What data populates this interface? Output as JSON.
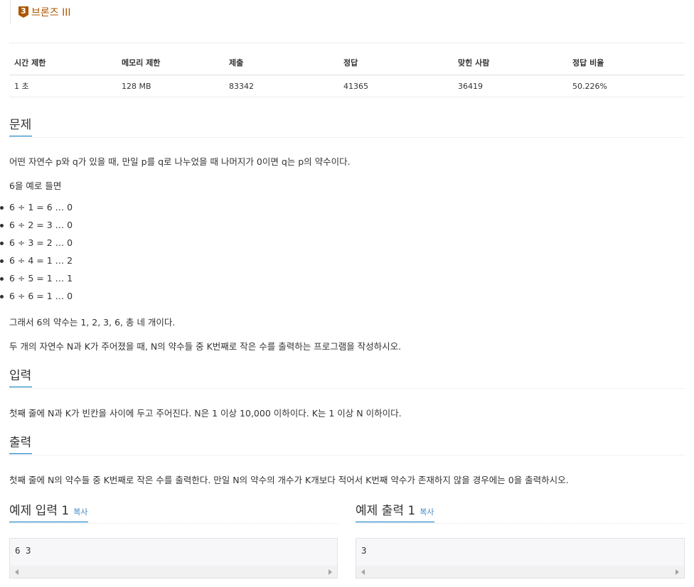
{
  "tier": {
    "badge": "3",
    "label": "브론즈 III"
  },
  "info_table": {
    "headers": [
      "시간 제한",
      "메모리 제한",
      "제출",
      "정답",
      "맞힌 사람",
      "정답 비율"
    ],
    "values": [
      "1 초",
      "128 MB",
      "83342",
      "41365",
      "36419",
      "50.226%"
    ]
  },
  "problem": {
    "title": "문제",
    "para1": "어떤 자연수 p와 q가 있을 때, 만일 p를 q로 나누었을 때 나머지가 0이면 q는 p의 약수이다.",
    "para2": "6을 예로 들면",
    "list": [
      "6 ÷ 1 = 6 … 0",
      "6 ÷ 2 = 3 … 0",
      "6 ÷ 3 = 2 … 0",
      "6 ÷ 4 = 1 … 2",
      "6 ÷ 5 = 1 … 1",
      "6 ÷ 6 = 1 … 0"
    ],
    "para3": "그래서 6의 약수는 1, 2, 3, 6, 총 네 개이다.",
    "para4": "두 개의 자연수 N과 K가 주어졌을 때, N의 약수들 중 K번째로 작은 수를 출력하는 프로그램을 작성하시오."
  },
  "input": {
    "title": "입력",
    "text": "첫째 줄에 N과 K가 빈칸을 사이에 두고 주어진다. N은 1 이상 10,000 이하이다. K는 1 이상 N 이하이다."
  },
  "output": {
    "title": "출력",
    "text": "첫째 줄에 N의 약수들 중 K번째로 작은 수를 출력한다. 만일 N의 약수의 개수가 K개보다 적어서 K번째 약수가 존재하지 않을 경우에는 0을 출력하시오."
  },
  "sample_input": {
    "title": "예제 입력 1",
    "copy_label": "복사",
    "content": "6 3"
  },
  "sample_output": {
    "title": "예제 출력 1",
    "copy_label": "복사",
    "content": "3"
  },
  "colors": {
    "tier_bronze": "#ad5600",
    "accent": "#0076c0",
    "link": "#428bca"
  },
  "icons": [
    "scroll-left-arrow-icon",
    "scroll-right-arrow-icon",
    "bullet-icon"
  ]
}
